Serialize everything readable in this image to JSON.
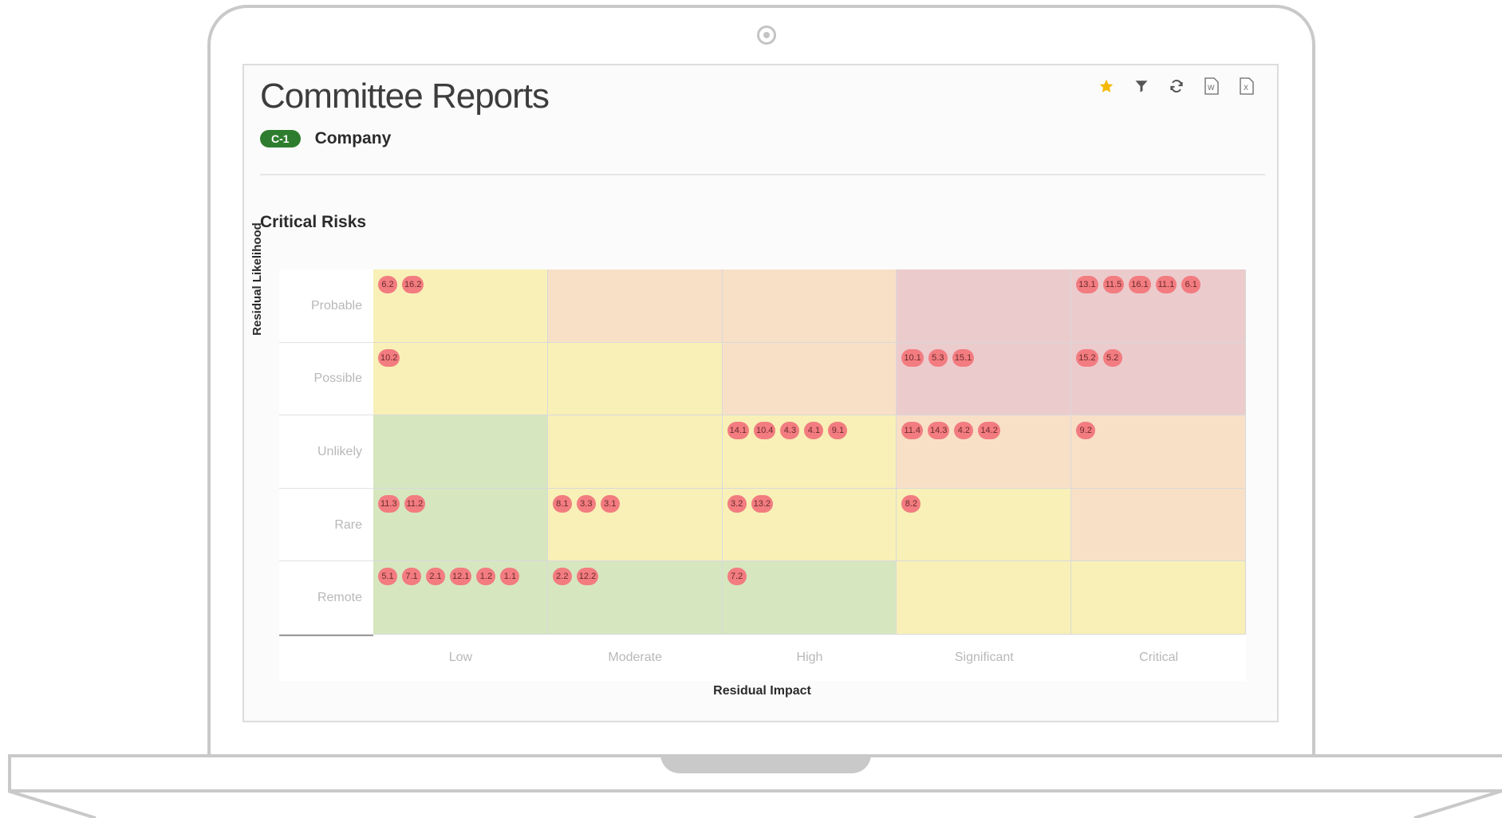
{
  "header": {
    "title": "Committee Reports",
    "badge": "C-1",
    "badge_label": "Company"
  },
  "toolbar": {
    "icons": [
      "star-icon",
      "filter-icon",
      "refresh-icon",
      "word-export-icon",
      "excel-export-icon"
    ],
    "star_color": "#f5b800"
  },
  "section": {
    "title": "Critical Risks"
  },
  "chart_data": {
    "type": "heatmap",
    "ylabel": "Residual Likelihood",
    "xlabel": "Residual Impact",
    "rows": [
      "Probable",
      "Possible",
      "Unlikely",
      "Rare",
      "Remote"
    ],
    "columns": [
      "Low",
      "Moderate",
      "High",
      "Significant",
      "Critical"
    ],
    "cell_colors": [
      [
        "yellow",
        "orange",
        "orange",
        "red",
        "red"
      ],
      [
        "yellow",
        "yellow",
        "orange",
        "red",
        "red"
      ],
      [
        "green",
        "yellow",
        "yellow",
        "orange",
        "orange"
      ],
      [
        "green",
        "yellow",
        "yellow",
        "yellow",
        "orange"
      ],
      [
        "green",
        "green",
        "green",
        "yellow",
        "yellow"
      ]
    ],
    "color_map": {
      "green": "#d6e7c0",
      "yellow": "#f8f0b7",
      "orange": "#f8e0c7",
      "red": "#eccbcd",
      "marker": "#f27c80"
    },
    "risks": [
      [
        [
          "6.2",
          "16.2"
        ],
        [],
        [],
        [],
        [
          "13.1",
          "11.5",
          "16.1",
          "11.1",
          "6.1"
        ]
      ],
      [
        [
          "10.2"
        ],
        [],
        [],
        [
          "10.1",
          "5.3",
          "15.1"
        ],
        [
          "15.2",
          "5.2"
        ]
      ],
      [
        [],
        [],
        [
          "14.1",
          "10.4",
          "4.3",
          "4.1",
          "9.1"
        ],
        [
          "11.4",
          "14.3",
          "4.2",
          "14.2"
        ],
        [
          "9.2"
        ]
      ],
      [
        [
          "11.3",
          "11.2"
        ],
        [
          "8.1",
          "3.3",
          "3.1"
        ],
        [
          "3.2",
          "13.2"
        ],
        [
          "8.2"
        ],
        []
      ],
      [
        [
          "5.1",
          "7.1",
          "2.1",
          "12.1",
          "1.2",
          "1.1"
        ],
        [
          "2.2",
          "12.2"
        ],
        [
          "7.2"
        ],
        [],
        []
      ]
    ]
  }
}
